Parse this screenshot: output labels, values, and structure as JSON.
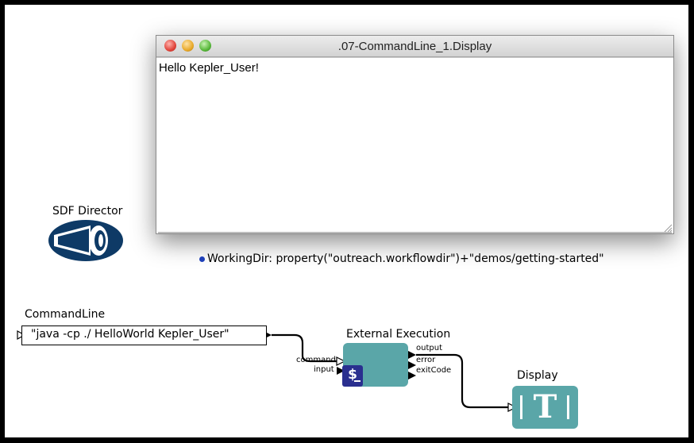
{
  "window": {
    "title": ".07-CommandLine_1.Display",
    "content": "Hello Kepler_User!"
  },
  "workflow": {
    "director": {
      "label": "SDF Director"
    },
    "parameter": {
      "text": "WorkingDir: property(\"outreach.workflowdir\")+\"demos/getting-started\""
    },
    "commandline": {
      "label": "CommandLine",
      "value": "\"java -cp ./ HelloWorld Kepler_User\""
    },
    "external_execution": {
      "label": "External Execution",
      "icon_text": "$",
      "input_ports": [
        "command",
        "input"
      ],
      "output_ports": [
        "output",
        "error",
        "exitCode"
      ]
    },
    "display": {
      "label": "Display",
      "icon_text": "T"
    }
  },
  "colors": {
    "actor_fill": "#5aa6a8",
    "director_fill": "#0e3a66",
    "dollar_fill": "#2a2f8f",
    "param_dot": "#1d3fb8"
  }
}
